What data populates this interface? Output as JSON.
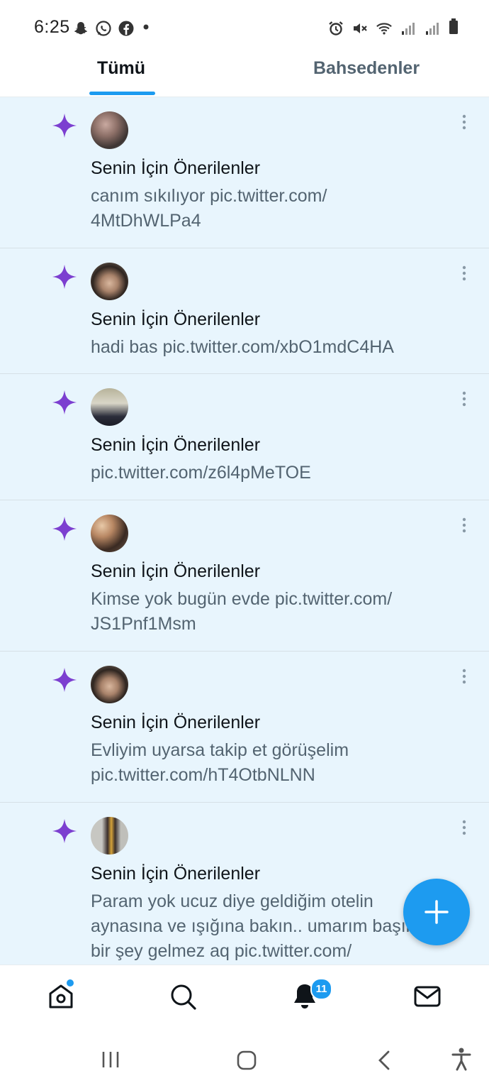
{
  "status_bar": {
    "time": "6:25",
    "left_icons": [
      "snapchat-icon",
      "whatsapp-icon",
      "facebook-icon",
      "dot-icon"
    ],
    "right_icons": [
      "alarm-icon",
      "mute-icon",
      "wifi-icon",
      "signal-icon",
      "signal-icon",
      "battery-icon"
    ]
  },
  "tabs": [
    {
      "label": "Tümü",
      "active": true
    },
    {
      "label": "Bahsedenler",
      "active": false
    }
  ],
  "notifications": [
    {
      "title": "Senin İçin Önerilenler",
      "text": "canım sıkılıyor pic.twitter.com/\n4MtDhWLPa4",
      "icon": "sparkle-icon"
    },
    {
      "title": "Senin İçin Önerilenler",
      "text": "hadi bas pic.twitter.com/xbO1mdC4HA",
      "icon": "sparkle-icon"
    },
    {
      "title": "Senin İçin Önerilenler",
      "text": "pic.twitter.com/z6l4pMeTOE",
      "icon": "sparkle-icon"
    },
    {
      "title": "Senin İçin Önerilenler",
      "text": "Kimse yok bugün evde pic.twitter.com/\nJS1Pnf1Msm",
      "icon": "sparkle-icon"
    },
    {
      "title": "Senin İçin Önerilenler",
      "text": "Evliyim uyarsa takip et görüşelim\npic.twitter.com/hT4OtbNLNN",
      "icon": "sparkle-icon"
    },
    {
      "title": "Senin İçin Önerilenler",
      "text": "Param yok ucuz diye geldiğim otelin aynasına ve ışığına bakın.. umarım başıma bir şey gelmez aq pic.twitter.com/",
      "icon": "sparkle-icon"
    }
  ],
  "bottom_nav": {
    "items": [
      "home-icon",
      "search-icon",
      "notifications-icon",
      "messages-icon"
    ],
    "notification_badge": "11"
  },
  "colors": {
    "accent": "#1d9bf0",
    "sparkle": "#7c3fd0",
    "feed_background": "#e8f5fd"
  }
}
